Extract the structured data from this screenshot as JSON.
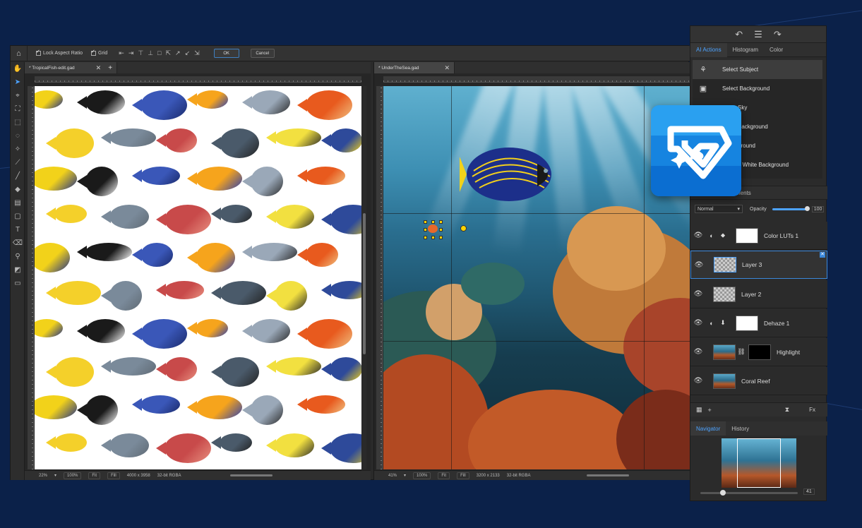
{
  "topbar": {
    "lock_aspect_ratio": "Lock Aspect Ratio",
    "grid": "Grid",
    "ok": "OK",
    "cancel": "Cancel"
  },
  "documents": [
    {
      "tab": "* TropicalFish-edit.gad",
      "zoom": "22%",
      "zoom_100": "100%",
      "fit": "Fit",
      "fill": "Fill",
      "size": "4000 x 3958",
      "mode": "32-bit RGBA"
    },
    {
      "tab": "* UnderTheSea.gad",
      "zoom": "41%",
      "zoom_100": "100%",
      "fit": "Fit",
      "fill": "Fill",
      "size": "3200 x 2133",
      "mode": "32-bit RGBA"
    }
  ],
  "right_panel": {
    "tabs": [
      "AI Actions",
      "Histogram",
      "Color"
    ],
    "ai_actions": [
      "Select Subject",
      "Select Background",
      "Sky",
      "Background",
      "ground",
      "d White Background"
    ],
    "layers_tab_fragment": "ments",
    "blend_mode": "Normal",
    "opacity_label": "Opacity",
    "opacity_value": "100",
    "layers": [
      {
        "name": "Color LUTs 1"
      },
      {
        "name": "Layer 3"
      },
      {
        "name": "Layer 2"
      },
      {
        "name": "Dehaze 1"
      },
      {
        "name": "Highlight"
      },
      {
        "name": "Coral Reef"
      }
    ],
    "navigator_tabs": [
      "Navigator",
      "History"
    ],
    "navigator_zoom": "41"
  },
  "colors": {
    "accent": "#4da3ff",
    "background": "#0b2149",
    "logo": "#0b6ed1"
  }
}
